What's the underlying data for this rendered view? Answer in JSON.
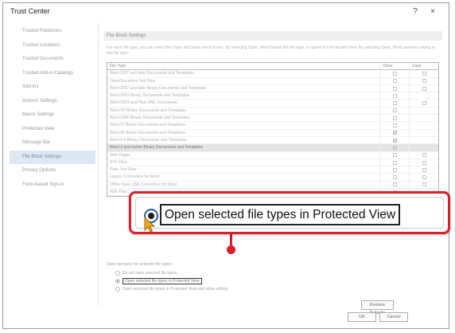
{
  "window": {
    "title": "Trust Center",
    "help_label": "?",
    "close_label": "×"
  },
  "sidebar": {
    "items": [
      {
        "label": "Trusted Publishers",
        "selected": false
      },
      {
        "label": "Trusted Locations",
        "selected": false
      },
      {
        "label": "Trusted Documents",
        "selected": false
      },
      {
        "label": "Trusted Add-in Catalogs",
        "selected": false
      },
      {
        "label": "Add-ins",
        "selected": false
      },
      {
        "label": "ActiveX Settings",
        "selected": false
      },
      {
        "label": "Macro Settings",
        "selected": false
      },
      {
        "label": "Protected View",
        "selected": false
      },
      {
        "label": "Message Bar",
        "selected": false
      },
      {
        "label": "File Block Settings",
        "selected": true
      },
      {
        "label": "Privacy Options",
        "selected": false
      },
      {
        "label": "Form-based Sign-in",
        "selected": false
      }
    ]
  },
  "main": {
    "section_title": "File Block Settings",
    "description": "For each file type, you can select the Open and Save check boxes. By selecting Open, Word blocks this file type, or opens it in Protected View. By selecting Save, Word prevents saving in this file type.",
    "table": {
      "headers": {
        "file_type": "File Type",
        "open": "Open",
        "save": "Save"
      },
      "rows": [
        {
          "label": "Word 2007 and later Documents and Templates",
          "open": false,
          "save": false,
          "selected": false
        },
        {
          "label": "OpenDocument Text Files",
          "open": false,
          "save": false,
          "selected": false
        },
        {
          "label": "Word 2007 and later Binary Documents and Templates",
          "open": false,
          "save": false,
          "selected": false
        },
        {
          "label": "Word 2003 Binary Documents and Templates",
          "open": false,
          "save": null,
          "selected": false
        },
        {
          "label": "Word 2003 and Plain XML Documents",
          "open": false,
          "save": false,
          "selected": false
        },
        {
          "label": "Word XP Binary Documents and Templates",
          "open": false,
          "save": null,
          "selected": false
        },
        {
          "label": "Word 2000 Binary Documents and Templates",
          "open": false,
          "save": null,
          "selected": false
        },
        {
          "label": "Word 97 Binary Documents and Templates",
          "open": false,
          "save": null,
          "selected": false
        },
        {
          "label": "Word 95 Binary Documents and Templates",
          "open": true,
          "save": null,
          "selected": false
        },
        {
          "label": "Word 6.0 Binary Documents and Templates",
          "open": true,
          "save": null,
          "selected": false
        },
        {
          "label": "Word 2 and earlier Binary Documents and Templates",
          "open": true,
          "save": null,
          "selected": true
        },
        {
          "label": "Web Pages",
          "open": false,
          "save": false,
          "selected": false
        },
        {
          "label": "RTF Files",
          "open": false,
          "save": false,
          "selected": false
        },
        {
          "label": "Plain Text Files",
          "open": false,
          "save": false,
          "selected": false
        },
        {
          "label": "Legacy Converters for Word",
          "open": false,
          "save": false,
          "selected": false
        },
        {
          "label": "Office Open XML Converters for Word",
          "open": false,
          "save": false,
          "selected": false
        },
        {
          "label": "PDF Files",
          "open": false,
          "save": null,
          "selected": false
        }
      ]
    },
    "open_behavior_label": "Open behavior for selected file types:",
    "options": [
      {
        "label": "Do not open selected file types",
        "checked": false
      },
      {
        "label": "Open selected file types in Protected View",
        "checked": true
      },
      {
        "label": "Open selected file types in Protected View and allow editing",
        "checked": false
      }
    ],
    "restore_defaults_label": "Restore Defaults"
  },
  "footer": {
    "ok_label": "OK",
    "cancel_label": "Cancel"
  },
  "callout": {
    "label": "Open selected file types in Protected View"
  },
  "colors": {
    "callout_border": "#d6202a",
    "radio_ring": "#1f5fa8",
    "cursor": "#f2a51c"
  }
}
